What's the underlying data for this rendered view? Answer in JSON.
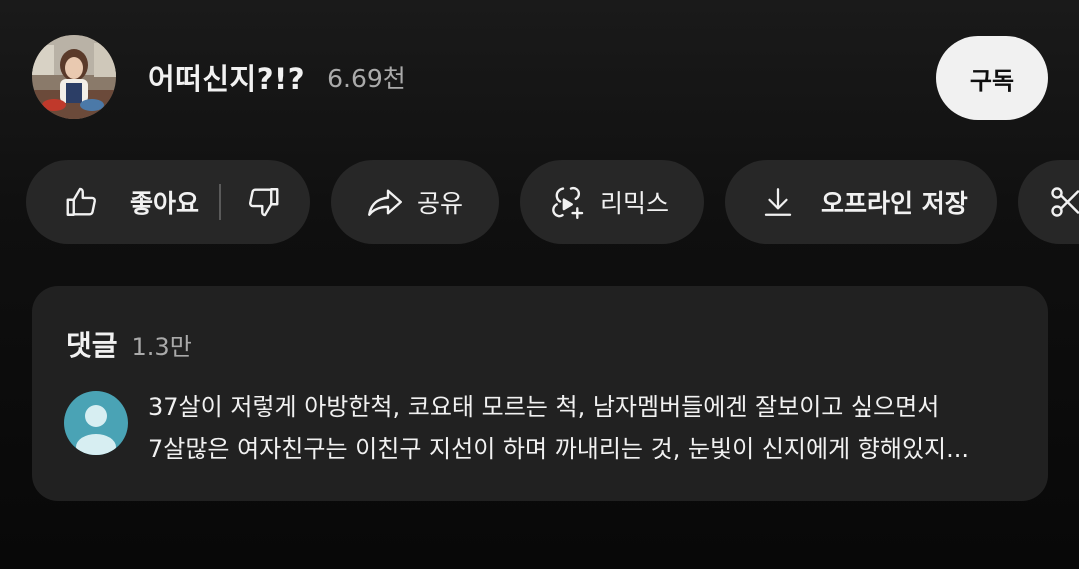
{
  "channel": {
    "name": "어떠신지?!?",
    "subscribers": "6.69천",
    "subscribe_label": "구독"
  },
  "actions": {
    "like_label": "좋아요",
    "share_label": "공유",
    "remix_label": "리믹스",
    "download_label": "오프라인 저장"
  },
  "comments": {
    "title": "댓글",
    "count": "1.3만",
    "top_comment": {
      "line1": "37살이 저렇게 아방한척, 코요태 모르는 척, 남자멤버들에겐 잘보이고 싶으면서",
      "line2": "7살많은 여자친구는 이친구 지선이 하며 까내리는 것, 눈빛이 신지에게 향해있지..."
    }
  },
  "colors": {
    "background": "#0f0f0f",
    "pill": "#272727",
    "card": "#212121",
    "subscribe_bg": "#f1f1f1",
    "avatar_default": "#4aa3b5"
  },
  "icons": [
    "thumbs-up-icon",
    "thumbs-down-icon",
    "share-icon",
    "remix-icon",
    "download-icon",
    "clip-icon"
  ]
}
